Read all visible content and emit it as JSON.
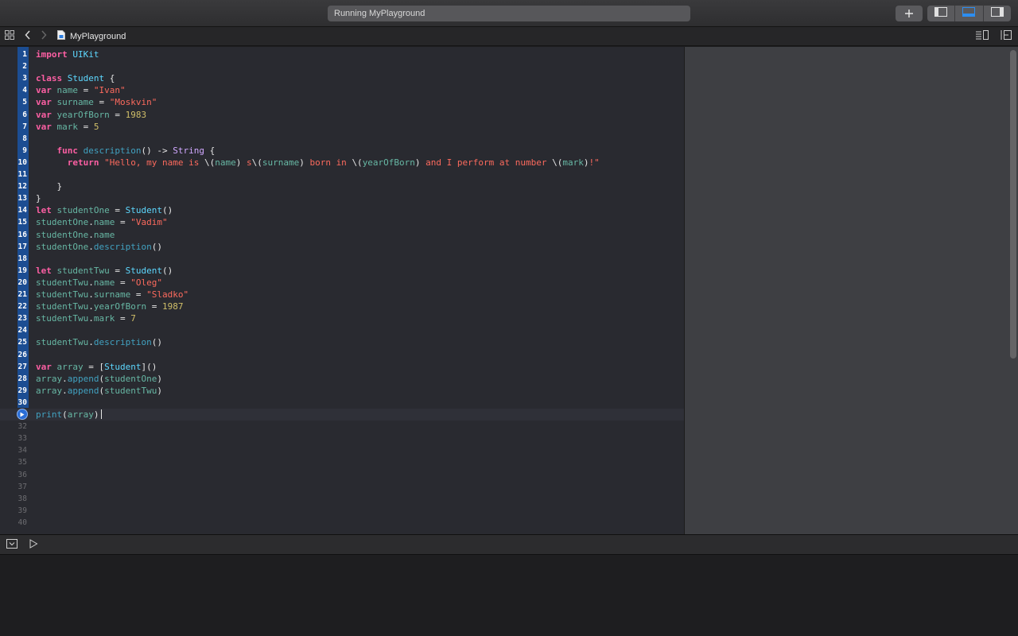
{
  "toolbar": {
    "status_text": "Running MyPlayground",
    "add_icon": "plus-icon",
    "navigator_toggle_icon": "left-panel-icon",
    "debug_toggle_icon": "bottom-panel-icon",
    "inspector_toggle_icon": "right-panel-icon"
  },
  "jumpbar": {
    "grid_icon": "grid-icon",
    "back_icon": "chevron-left-icon",
    "forward_icon": "chevron-right-icon",
    "file_icon": "playground-file-icon",
    "file_name": "MyPlayground",
    "editor_options_icon": "lines-icon",
    "assistant_icon": "split-editor-icon"
  },
  "editor": {
    "code_lines": [
      "import UIKit",
      "",
      "class Student {",
      "var name = \"Ivan\"",
      "var surname = \"Moskvin\"",
      "var yearOfBorn = 1983",
      "var mark = 5",
      "",
      "    func description() -> String {",
      "      return \"Hello, my name is \\(name) s\\(surname) born in \\(yearOfBorn) and I perform at number \\(mark)!\"",
      "",
      "    }",
      "}",
      "let studentOne = Student()",
      "studentOne.name = \"Vadim\"",
      "studentOne.name",
      "studentOne.description()",
      "",
      "let studentTwu = Student()",
      "studentTwu.name = \"Oleg\"",
      "studentTwu.surname = \"Sladko\"",
      "studentTwu.yearOfBorn = 1987",
      "studentTwu.mark = 7",
      "",
      "studentTwu.description()",
      "",
      "var array = [Student]()",
      "array.append(studentOne)",
      "array.append(studentTwu)",
      "",
      "print(array)",
      "",
      "",
      "",
      "",
      "",
      "",
      "",
      "",
      ""
    ],
    "line_numbers": [
      "1",
      "2",
      "3",
      "4",
      "5",
      "6",
      "7",
      "8",
      "9",
      "10",
      "11",
      "12",
      "13",
      "14",
      "15",
      "16",
      "17",
      "18",
      "19",
      "20",
      "21",
      "22",
      "23",
      "24",
      "25",
      "26",
      "27",
      "28",
      "29",
      "30",
      "31",
      "32",
      "33",
      "34",
      "35",
      "36",
      "37",
      "38",
      "39",
      "40"
    ],
    "executed_through_line": 30,
    "current_line": 31,
    "run_button_icon": "play-circle-icon"
  },
  "debug": {
    "hide_icon": "hide-debug-area-icon",
    "run_icon": "play-outline-icon"
  },
  "colors": {
    "keyword": "#fc5fa3",
    "type": "#d0a8ff",
    "class_name": "#5dd8ff",
    "property": "#67b7a4",
    "string": "#fc6a5d",
    "number": "#d0bf69",
    "function": "#41a1c0",
    "gutter_highlight": "#1c4d92"
  }
}
